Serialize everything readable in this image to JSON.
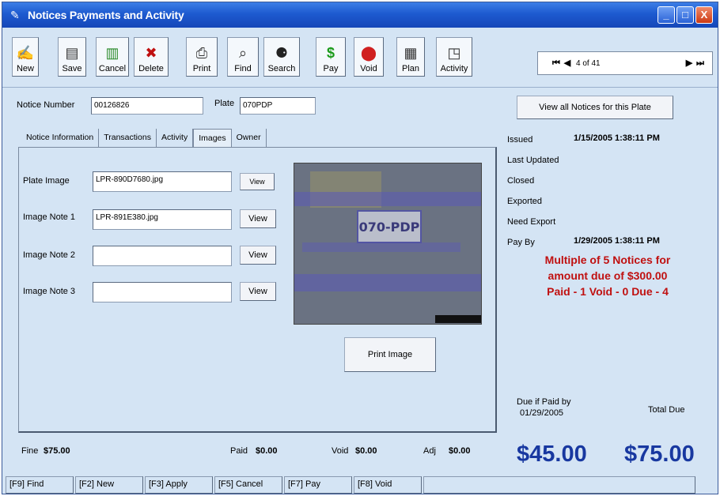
{
  "window": {
    "title": "Notices Payments and Activity",
    "controls": [
      "_",
      "□",
      "X"
    ]
  },
  "toolbar": {
    "buttons": [
      {
        "label": "New",
        "icon": "new-icon"
      },
      {
        "label": "Save",
        "icon": "save-icon"
      },
      {
        "label": "Cancel",
        "icon": "cancel-icon"
      },
      {
        "label": "Delete",
        "icon": "delete-icon"
      },
      {
        "label": "Print",
        "icon": "print-icon"
      },
      {
        "label": "Find",
        "icon": "find-icon"
      },
      {
        "label": "Search",
        "icon": "search-icon"
      },
      {
        "label": "Pay",
        "icon": "pay-icon"
      },
      {
        "label": "Void",
        "icon": "void-icon"
      },
      {
        "label": "Plan",
        "icon": "plan-icon"
      },
      {
        "label": "Activity",
        "icon": "activity-icon"
      }
    ],
    "nav": {
      "position": "4 of 41"
    }
  },
  "header": {
    "notice_number_label": "Notice Number",
    "notice_number_value": "00126826",
    "plate_label": "Plate",
    "plate_value": "070PDP",
    "view_all_button": "View all Notices for this Plate"
  },
  "tabs": [
    "Notice Information",
    "Transactions",
    "Activity",
    "Images",
    "Owner"
  ],
  "active_tab": "Images",
  "images": {
    "plate_image_label": "Plate Image",
    "plate_image_value": "LPR-890D7680.jpg",
    "note1_label": "Image Note 1",
    "note1_value": "LPR-891E380.jpg",
    "note2_label": "Image Note 2",
    "note2_value": "",
    "note3_label": "Image Note 3",
    "note3_value": "",
    "view_label": "View",
    "print_image_button": "Print Image",
    "plate_text": "070-PDP"
  },
  "details": {
    "issued_label": "Issued",
    "issued_value": "1/15/2005 1:38:11 PM",
    "last_updated_label": "Last Updated",
    "closed_label": "Closed",
    "exported_label": "Exported",
    "need_export_label": "Need Export",
    "pay_by_label": "Pay By",
    "pay_by_value": "1/29/2005 1:38:11 PM",
    "alert_line1": "Multiple of 5 Notices for",
    "alert_line2": "amount due of $300.00",
    "alert_line3": "Paid - 1 Void - 0 Due - 4",
    "due_if_paid_label_1": "Due if Paid by",
    "due_if_paid_label_2": "01/29/2005",
    "total_due_label": "Total Due",
    "due_if_paid_amount": "$45.00",
    "total_due_amount": "$75.00"
  },
  "totals": {
    "fine_label": "Fine",
    "fine_value": "$75.00",
    "paid_label": "Paid",
    "paid_value": "$0.00",
    "void_label": "Void",
    "void_value": "$0.00",
    "adj_label": "Adj",
    "adj_value": "$0.00"
  },
  "status_bar": [
    "[F9] Find",
    "[F2] New",
    "[F3] Apply",
    "[F5] Cancel",
    "[F7] Pay",
    "[F8] Void",
    ""
  ]
}
